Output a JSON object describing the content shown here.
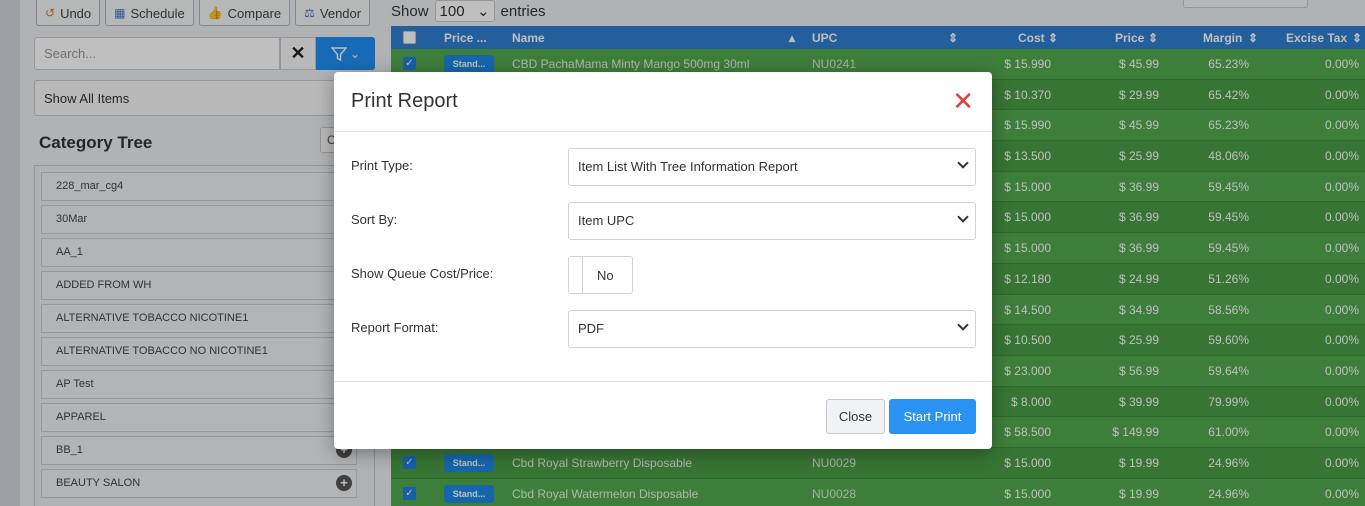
{
  "toolbar": {
    "undo_label": "Undo",
    "schedule_label": "Schedule",
    "compare_label": "Compare",
    "vendor_label": "Vendor"
  },
  "search": {
    "placeholder": "Search..."
  },
  "filter_select": {
    "value": "Show All Items"
  },
  "category_tree": {
    "title": "Category Tree",
    "items": [
      {
        "label": "228_mar_cg4"
      },
      {
        "label": "30Mar"
      },
      {
        "label": "AA_1"
      },
      {
        "label": "ADDED FROM WH"
      },
      {
        "label": "ALTERNATIVE TOBACCO NICOTINE1"
      },
      {
        "label": "ALTERNATIVE TOBACCO NO NICOTINE1"
      },
      {
        "label": "AP Test"
      },
      {
        "label": "APPAREL"
      },
      {
        "label": "BB_1"
      },
      {
        "label": "BEAUTY SALON"
      }
    ]
  },
  "entries": {
    "show_label": "Show",
    "value": "100",
    "entries_label": "entries"
  },
  "table": {
    "headers": {
      "price_type": "Price ...",
      "name": "Name",
      "upc": "UPC",
      "cost": "Cost",
      "price": "Price",
      "margin": "Margin",
      "excise_tax": "Excise Tax"
    },
    "rows": [
      {
        "badge": "Stand...",
        "name": "CBD PachaMama Minty Mango 500mg 30ml",
        "upc": "NU0241",
        "cost": "$ 15.990",
        "price": "$ 45.99",
        "margin": "65.23%",
        "tax": "0.00%"
      },
      {
        "badge": "",
        "name": "",
        "upc": "",
        "cost": "$ 10.370",
        "price": "$ 29.99",
        "margin": "65.42%",
        "tax": "0.00%"
      },
      {
        "badge": "",
        "name": "",
        "upc": "",
        "cost": "$ 15.990",
        "price": "$ 45.99",
        "margin": "65.23%",
        "tax": "0.00%"
      },
      {
        "badge": "",
        "name": "",
        "upc": "",
        "cost": "$ 13.500",
        "price": "$ 25.99",
        "margin": "48.06%",
        "tax": "0.00%"
      },
      {
        "badge": "",
        "name": "",
        "upc": "",
        "cost": "$ 15.000",
        "price": "$ 36.99",
        "margin": "59.45%",
        "tax": "0.00%"
      },
      {
        "badge": "",
        "name": "",
        "upc": "",
        "cost": "$ 15.000",
        "price": "$ 36.99",
        "margin": "59.45%",
        "tax": "0.00%"
      },
      {
        "badge": "",
        "name": "",
        "upc": "",
        "cost": "$ 15.000",
        "price": "$ 36.99",
        "margin": "59.45%",
        "tax": "0.00%"
      },
      {
        "badge": "",
        "name": "",
        "upc": "",
        "cost": "$ 12.180",
        "price": "$ 24.99",
        "margin": "51.26%",
        "tax": "0.00%"
      },
      {
        "badge": "",
        "name": "",
        "upc": "",
        "cost": "$ 14.500",
        "price": "$ 34.99",
        "margin": "58.56%",
        "tax": "0.00%"
      },
      {
        "badge": "",
        "name": "",
        "upc": "",
        "cost": "$ 10.500",
        "price": "$ 25.99",
        "margin": "59.60%",
        "tax": "0.00%"
      },
      {
        "badge": "",
        "name": "",
        "upc": "",
        "cost": "$ 23.000",
        "price": "$ 56.99",
        "margin": "59.64%",
        "tax": "0.00%"
      },
      {
        "badge": "",
        "name": "",
        "upc": "",
        "cost": "$ 8.000",
        "price": "$ 39.99",
        "margin": "79.99%",
        "tax": "0.00%"
      },
      {
        "badge": "",
        "name": "",
        "upc": "",
        "cost": "$ 58.500",
        "price": "$ 149.99",
        "margin": "61.00%",
        "tax": "0.00%"
      },
      {
        "badge": "Stand...",
        "name": "Cbd Royal Strawberry Disposable",
        "upc": "NU0029",
        "cost": "$ 15.000",
        "price": "$ 19.99",
        "margin": "24.96%",
        "tax": "0.00%"
      },
      {
        "badge": "Stand...",
        "name": "Cbd Royal Watermelon Disposable",
        "upc": "NU0028",
        "cost": "$ 15.000",
        "price": "$ 19.99",
        "margin": "24.96%",
        "tax": "0.00%"
      }
    ]
  },
  "modal": {
    "title": "Print Report",
    "print_type_label": "Print Type:",
    "print_type_value": "Item List With Tree Information Report",
    "sort_by_label": "Sort By:",
    "sort_by_value": "Item UPC",
    "show_queue_label": "Show Queue Cost/Price:",
    "show_queue_value": "No",
    "report_format_label": "Report Format:",
    "report_format_value": "PDF",
    "close_label": "Close",
    "start_label": "Start Print"
  },
  "colors": {
    "row_green": "#53a84f",
    "header_blue": "#2f7fd1",
    "primary_button": "#2a92f0",
    "close_x": "#e0413d"
  }
}
